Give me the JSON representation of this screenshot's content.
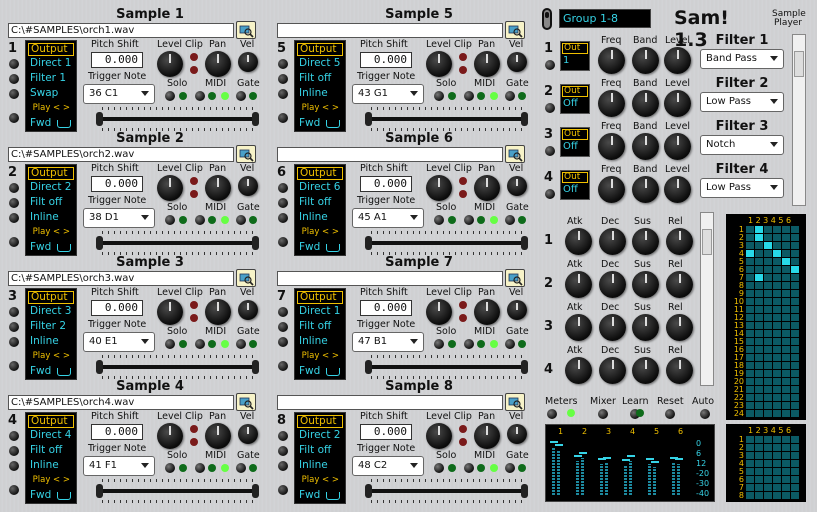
{
  "samples": [
    {
      "n": "1",
      "title": "Sample 1",
      "file": "C:\\#SAMPLES\\orch1.wav",
      "out": "Output",
      "l2": "Direct 1",
      "l3": "Filter 1",
      "l4": "Swap",
      "play": "Play < >",
      "fwd": "Fwd",
      "pitch": "0.000",
      "note": "36  C1"
    },
    {
      "n": "2",
      "title": "Sample 2",
      "file": "C:\\#SAMPLES\\orch2.wav",
      "out": "Output",
      "l2": "Direct 2",
      "l3": "Filt off",
      "l4": "Inline",
      "play": "Play < >",
      "fwd": "Fwd",
      "pitch": "0.000",
      "note": "38  D1"
    },
    {
      "n": "3",
      "title": "Sample 3",
      "file": "C:\\#SAMPLES\\orch3.wav",
      "out": "Output",
      "l2": "Direct 3",
      "l3": "Filter 2",
      "l4": "Inline",
      "play": "Play < >",
      "fwd": "Fwd",
      "pitch": "0.000",
      "note": "40  E1"
    },
    {
      "n": "4",
      "title": "Sample 4",
      "file": "C:\\#SAMPLES\\orch4.wav",
      "out": "Output",
      "l2": "Direct 4",
      "l3": "Filt off",
      "l4": "Inline",
      "play": "Play < >",
      "fwd": "Fwd",
      "pitch": "0.000",
      "note": "41  F1"
    },
    {
      "n": "5",
      "title": "Sample 5",
      "file": "",
      "out": "Output",
      "l2": "Direct 5",
      "l3": "Filt off",
      "l4": "Inline",
      "play": "Play < >",
      "fwd": "Fwd",
      "pitch": "0.000",
      "note": "43  G1"
    },
    {
      "n": "6",
      "title": "Sample 6",
      "file": "",
      "out": "Output",
      "l2": "Direct 6",
      "l3": "Filt off",
      "l4": "Inline",
      "play": "Play < >",
      "fwd": "Fwd",
      "pitch": "0.000",
      "note": "45  A1"
    },
    {
      "n": "7",
      "title": "Sample 7",
      "file": "",
      "out": "Output",
      "l2": "Direct 1",
      "l3": "Filt off",
      "l4": "Inline",
      "play": "Play < >",
      "fwd": "Fwd",
      "pitch": "0.000",
      "note": "47  B1"
    },
    {
      "n": "8",
      "title": "Sample 8",
      "file": "",
      "out": "Output",
      "l2": "Direct 2",
      "l3": "Filt off",
      "l4": "Inline",
      "play": "Play < >",
      "fwd": "Fwd",
      "pitch": "0.000",
      "note": "48  C2"
    }
  ],
  "labels": {
    "pitch": "Pitch Shift",
    "level": "Level",
    "clip": "Clip",
    "pan": "Pan",
    "vel": "Vel",
    "trigger": "Trigger Note",
    "solo": "Solo",
    "midi": "MIDI",
    "gate": "Gate"
  },
  "header": {
    "group": "Group 1-8",
    "app_title": "Sam! 1.3",
    "subtitle1": "Sample",
    "subtitle2": "Player"
  },
  "filters": [
    {
      "n": "1",
      "out": "Out",
      "val": "1",
      "title": "Filter 1",
      "type": "Band Pass"
    },
    {
      "n": "2",
      "out": "Out",
      "val": "Off",
      "title": "Filter 2",
      "type": "Low Pass"
    },
    {
      "n": "3",
      "out": "Out",
      "val": "Off",
      "title": "Filter 3",
      "type": "Notch"
    },
    {
      "n": "4",
      "out": "Out",
      "val": "Off",
      "title": "Filter 4",
      "type": "Low Pass"
    }
  ],
  "filter_labels": {
    "freq": "Freq",
    "band": "Band",
    "level": "Level"
  },
  "env": [
    {
      "n": "1"
    },
    {
      "n": "2"
    },
    {
      "n": "3"
    },
    {
      "n": "4"
    }
  ],
  "env_labels": {
    "atk": "Atk",
    "dec": "Dec",
    "sus": "Sus",
    "rel": "Rel"
  },
  "bottom": {
    "meters": "Meters",
    "mixer": "Mixer",
    "learn": "Learn",
    "reset": "Reset",
    "auto": "Auto"
  },
  "grid_header": "123456",
  "grid_rows": [
    "1",
    "2",
    "3",
    "4",
    "5",
    "6",
    "7",
    "8",
    "9",
    "10",
    "11",
    "12",
    "13",
    "14",
    "15",
    "16",
    "17",
    "18",
    "19",
    "20",
    "21",
    "22",
    "23",
    "24"
  ],
  "grid2_rows": [
    "1",
    "2",
    "3",
    "4",
    "5",
    "6",
    "7",
    "8"
  ],
  "meter_cols": [
    "1",
    "2",
    "3",
    "4",
    "5",
    "6"
  ],
  "meter_scale": [
    "0",
    "6",
    "12",
    "-20",
    "-30",
    "-40"
  ],
  "meter_levels": [
    0.78,
    0.72,
    0.55,
    0.6,
    0.5,
    0.52,
    0.48,
    0.55,
    0.5,
    0.45,
    0.52,
    0.5
  ],
  "colors": {
    "accent": "#36d3e6",
    "output": "#f0c000",
    "led_on": "#66ff44"
  }
}
